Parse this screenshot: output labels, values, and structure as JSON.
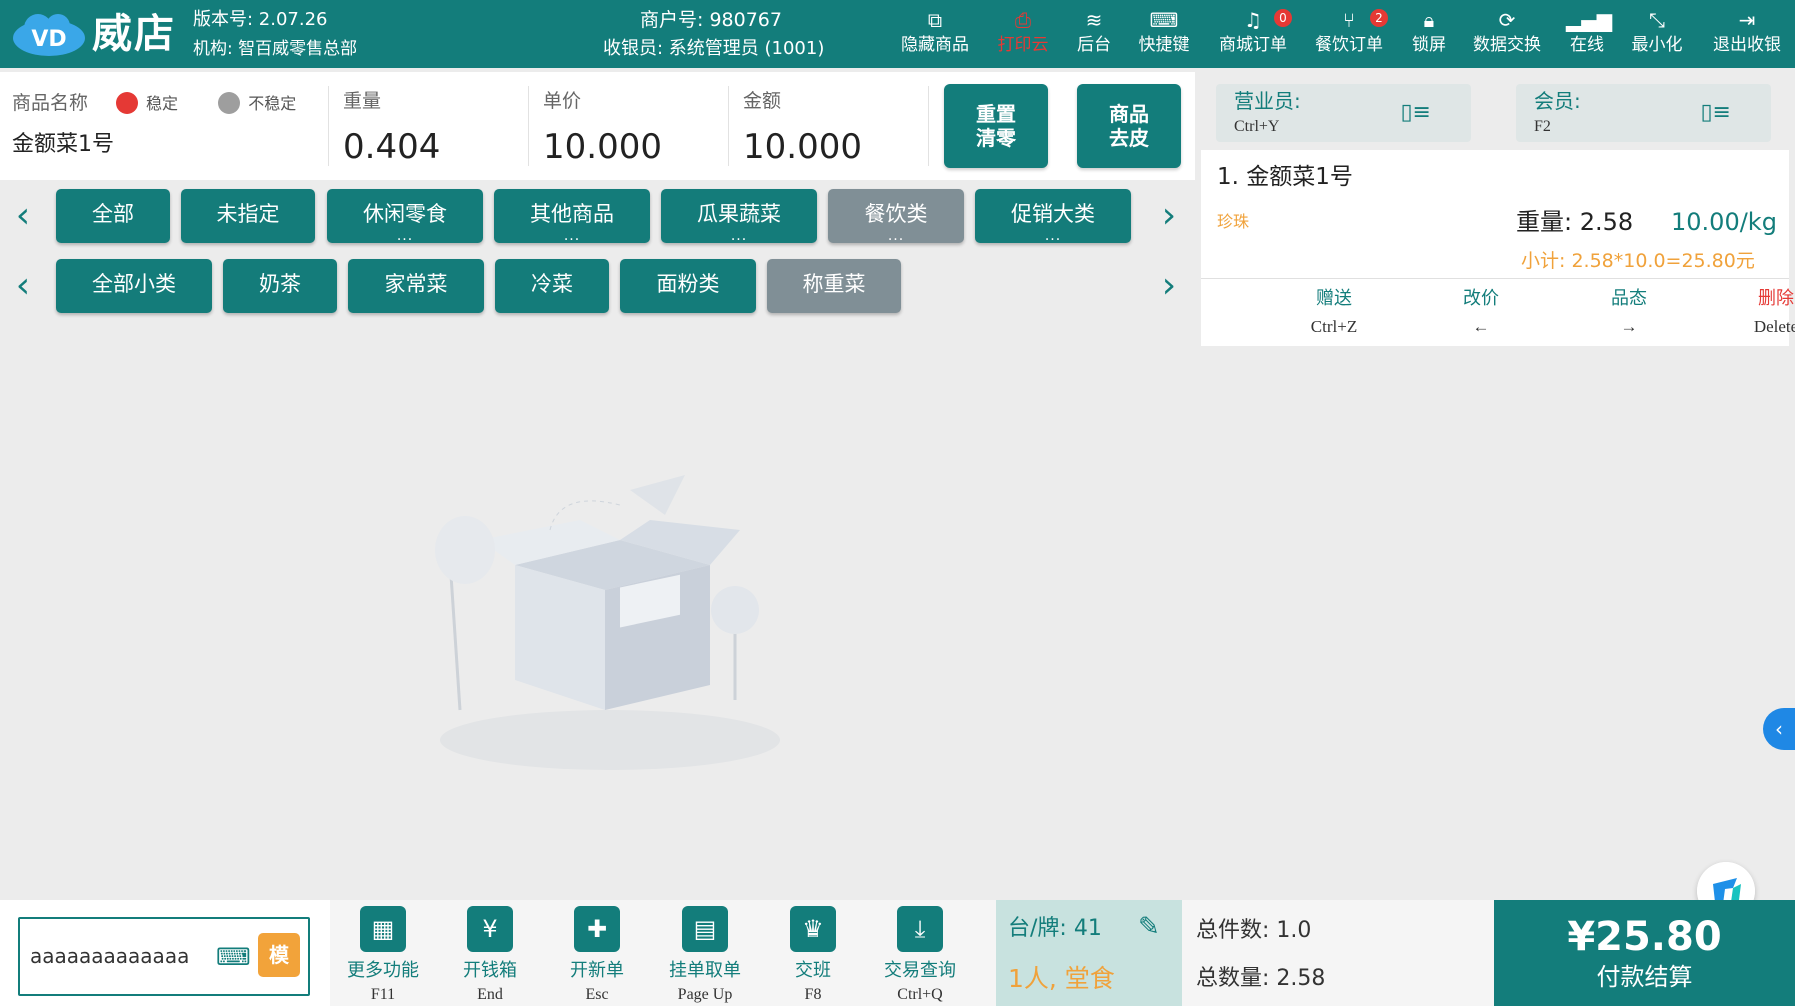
{
  "header": {
    "brand": "威店",
    "logo_text": "VD",
    "version": "版本号: 2.07.26",
    "org": "机构: 智百威零售总部",
    "merchant": "商户号: 980767",
    "cashier": "收银员: 系统管理员 (1001)",
    "buttons": [
      {
        "label": "隐藏商品",
        "icon": "hide-icon"
      },
      {
        "label": "打印云",
        "icon": "print-icon"
      },
      {
        "label": "后台",
        "icon": "layers-icon"
      },
      {
        "label": "快捷键",
        "icon": "keyboard-icon"
      },
      {
        "label": "商城订单",
        "icon": "mall-icon",
        "badge": "0"
      },
      {
        "label": "餐饮订单",
        "icon": "dining-icon",
        "badge": "2"
      },
      {
        "label": "锁屏",
        "icon": "lock-icon"
      },
      {
        "label": "数据交换",
        "icon": "sync-icon"
      },
      {
        "label": "在线",
        "icon": "signal-icon"
      },
      {
        "label": "最小化",
        "icon": "minimize-icon"
      },
      {
        "label": "退出收银",
        "icon": "exit-icon"
      }
    ]
  },
  "weigh": {
    "name_label": "商品名称",
    "stable_label": "稳定",
    "unstable_label": "不稳定",
    "product_name": "金额菜1号",
    "weight_label": "重量",
    "weight_value": "0.404",
    "price_label": "单价",
    "price_value": "10.000",
    "amount_label": "金额",
    "amount_value": "10.000",
    "reset_label_1": "重置",
    "reset_label_2": "清零",
    "tare_label_1": "商品",
    "tare_label_2": "去皮",
    "colors": {
      "stable": "#e53935",
      "unstable": "#9e9e9e"
    }
  },
  "categories": {
    "row1": [
      {
        "label": "全部",
        "more": ""
      },
      {
        "label": "未指定",
        "more": ""
      },
      {
        "label": "休闲零食",
        "more": "..."
      },
      {
        "label": "其他商品",
        "more": "..."
      },
      {
        "label": "瓜果蔬菜",
        "more": "..."
      },
      {
        "label": "餐饮类",
        "more": "..."
      },
      {
        "label": "促销大类",
        "more": "..."
      }
    ],
    "row2": [
      {
        "label": "全部小类"
      },
      {
        "label": "奶茶"
      },
      {
        "label": "家常菜"
      },
      {
        "label": "冷菜"
      },
      {
        "label": "面粉类"
      },
      {
        "label": "称重菜"
      }
    ],
    "prev_arrow": "‹",
    "next_arrow": "›"
  },
  "right": {
    "salesperson_label": "营业员:",
    "salesperson_key": "Ctrl+Y",
    "member_label": "会员:",
    "member_key": "F2",
    "order": {
      "name": "1.  金额菜1号",
      "tag": "珍珠",
      "weight": "重量: 2.58",
      "price": "10.00/kg",
      "subtotal": "小计: 2.58*10.0=25.80元",
      "actions": [
        {
          "label": "赠送",
          "key": "Ctrl+Z"
        },
        {
          "label": "改价",
          "key": "←"
        },
        {
          "label": "品态",
          "key": "→"
        },
        {
          "label": "删除",
          "key": "Delete"
        }
      ]
    },
    "side_tab": "‹"
  },
  "bottom": {
    "scan_value": "aaaaaaaaaaaaa",
    "mode_label": "模",
    "functions": [
      {
        "label": "更多功能",
        "key": "F11",
        "icon": "grid-icon"
      },
      {
        "label": "开钱箱",
        "key": "End",
        "icon": "cashbox-icon"
      },
      {
        "label": "开新单",
        "key": "Esc",
        "icon": "new-order-icon"
      },
      {
        "label": "挂单取单",
        "key": "Page Up",
        "icon": "clipboard-icon"
      },
      {
        "label": "交班",
        "key": "F8",
        "icon": "crown-icon"
      },
      {
        "label": "交易查询",
        "key": "Ctrl+Q",
        "icon": "download-icon"
      }
    ],
    "table_no": "台/牌: 41",
    "dine_type": "1人, 堂食",
    "total_items": "总件数: 1.0",
    "total_qty": "总数量: 2.58",
    "pay_amount": "¥25.80",
    "pay_label": "付款结算"
  }
}
